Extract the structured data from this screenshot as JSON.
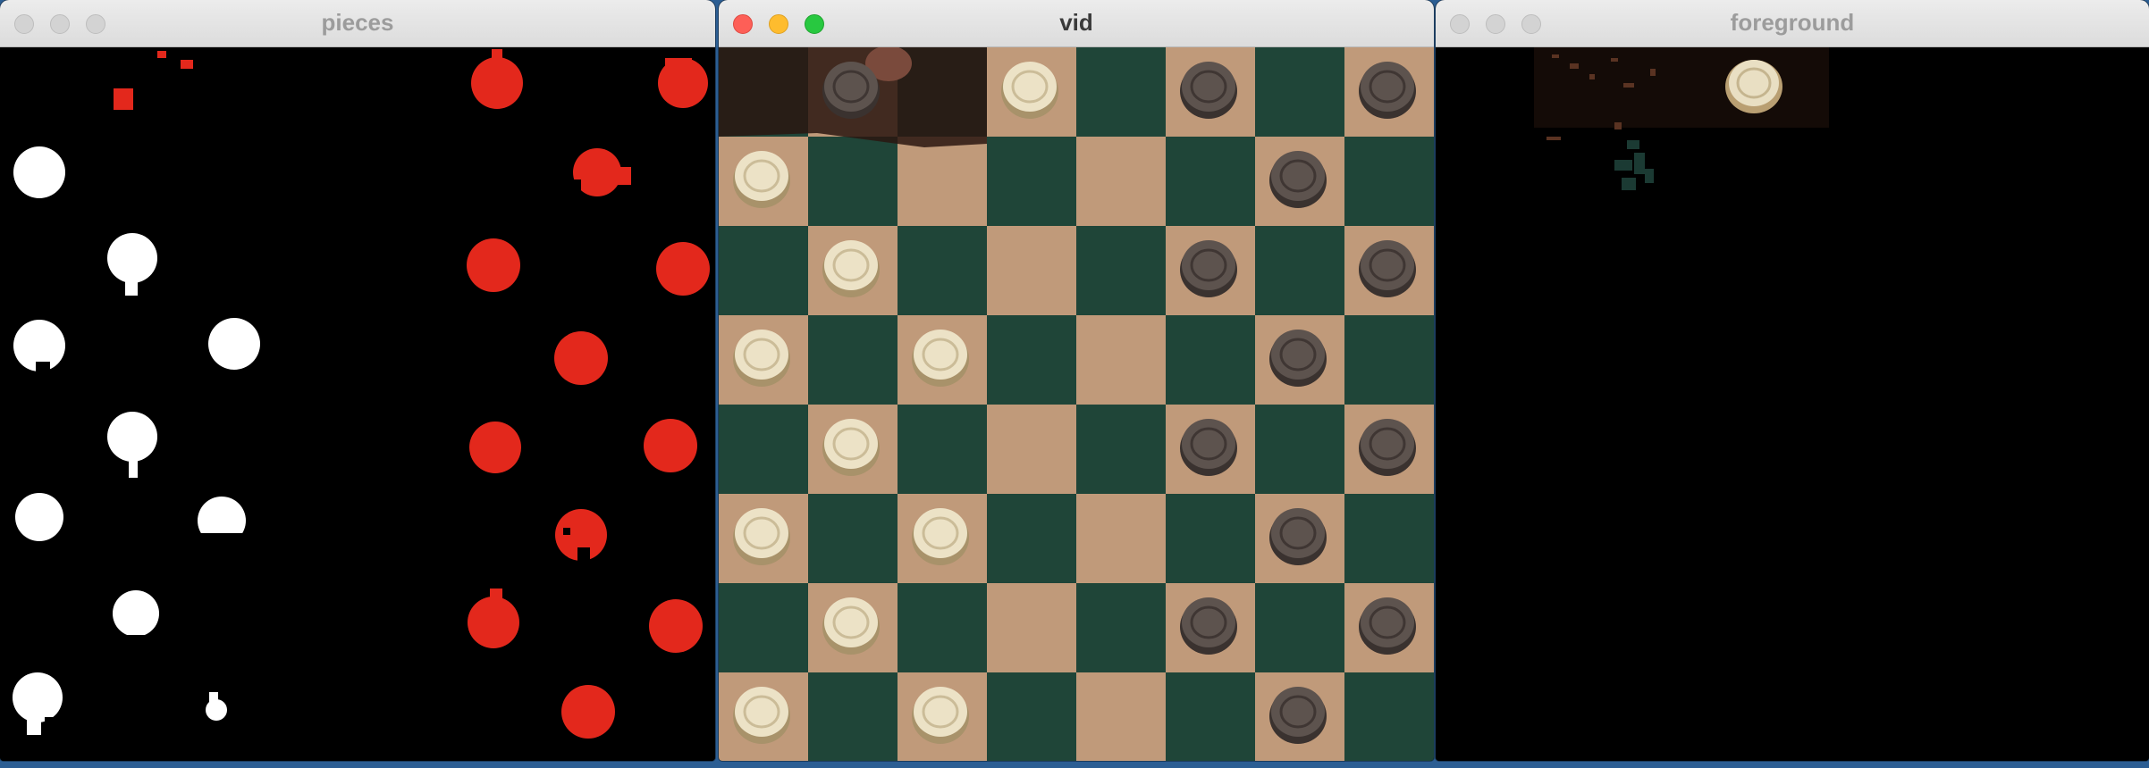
{
  "windows": [
    {
      "title": "pieces",
      "active": false
    },
    {
      "title": "vid",
      "active": true
    },
    {
      "title": "foreground",
      "active": false
    }
  ],
  "colors": {
    "desktop": "#2c5e93",
    "mask_red": "#e3281c",
    "mask_white": "#ffffff",
    "square_light": "#c09a7a",
    "square_dark": "#1f4538",
    "piece_light": "#ece2c6",
    "piece_dark": "#5d534e"
  },
  "icons": {
    "close": "close-traffic-light",
    "minimize": "minimize-traffic-light",
    "zoom": "zoom-traffic-light"
  }
}
